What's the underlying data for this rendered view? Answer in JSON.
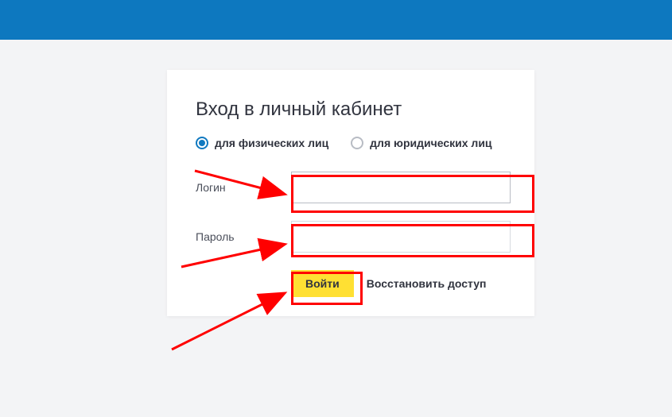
{
  "title": "Вход в личный кабинет",
  "radios": {
    "individual": "для физических лиц",
    "legal": "для юридических лиц"
  },
  "fields": {
    "login_label": "Логин",
    "login_value": "",
    "password_label": "Пароль",
    "password_value": ""
  },
  "actions": {
    "submit": "Войти",
    "recover": "Восстановить доступ"
  },
  "colors": {
    "header_bg": "#0d78bf",
    "accent": "#1079c0",
    "submit_bg": "#ffe033",
    "highlight": "#ff0000"
  }
}
